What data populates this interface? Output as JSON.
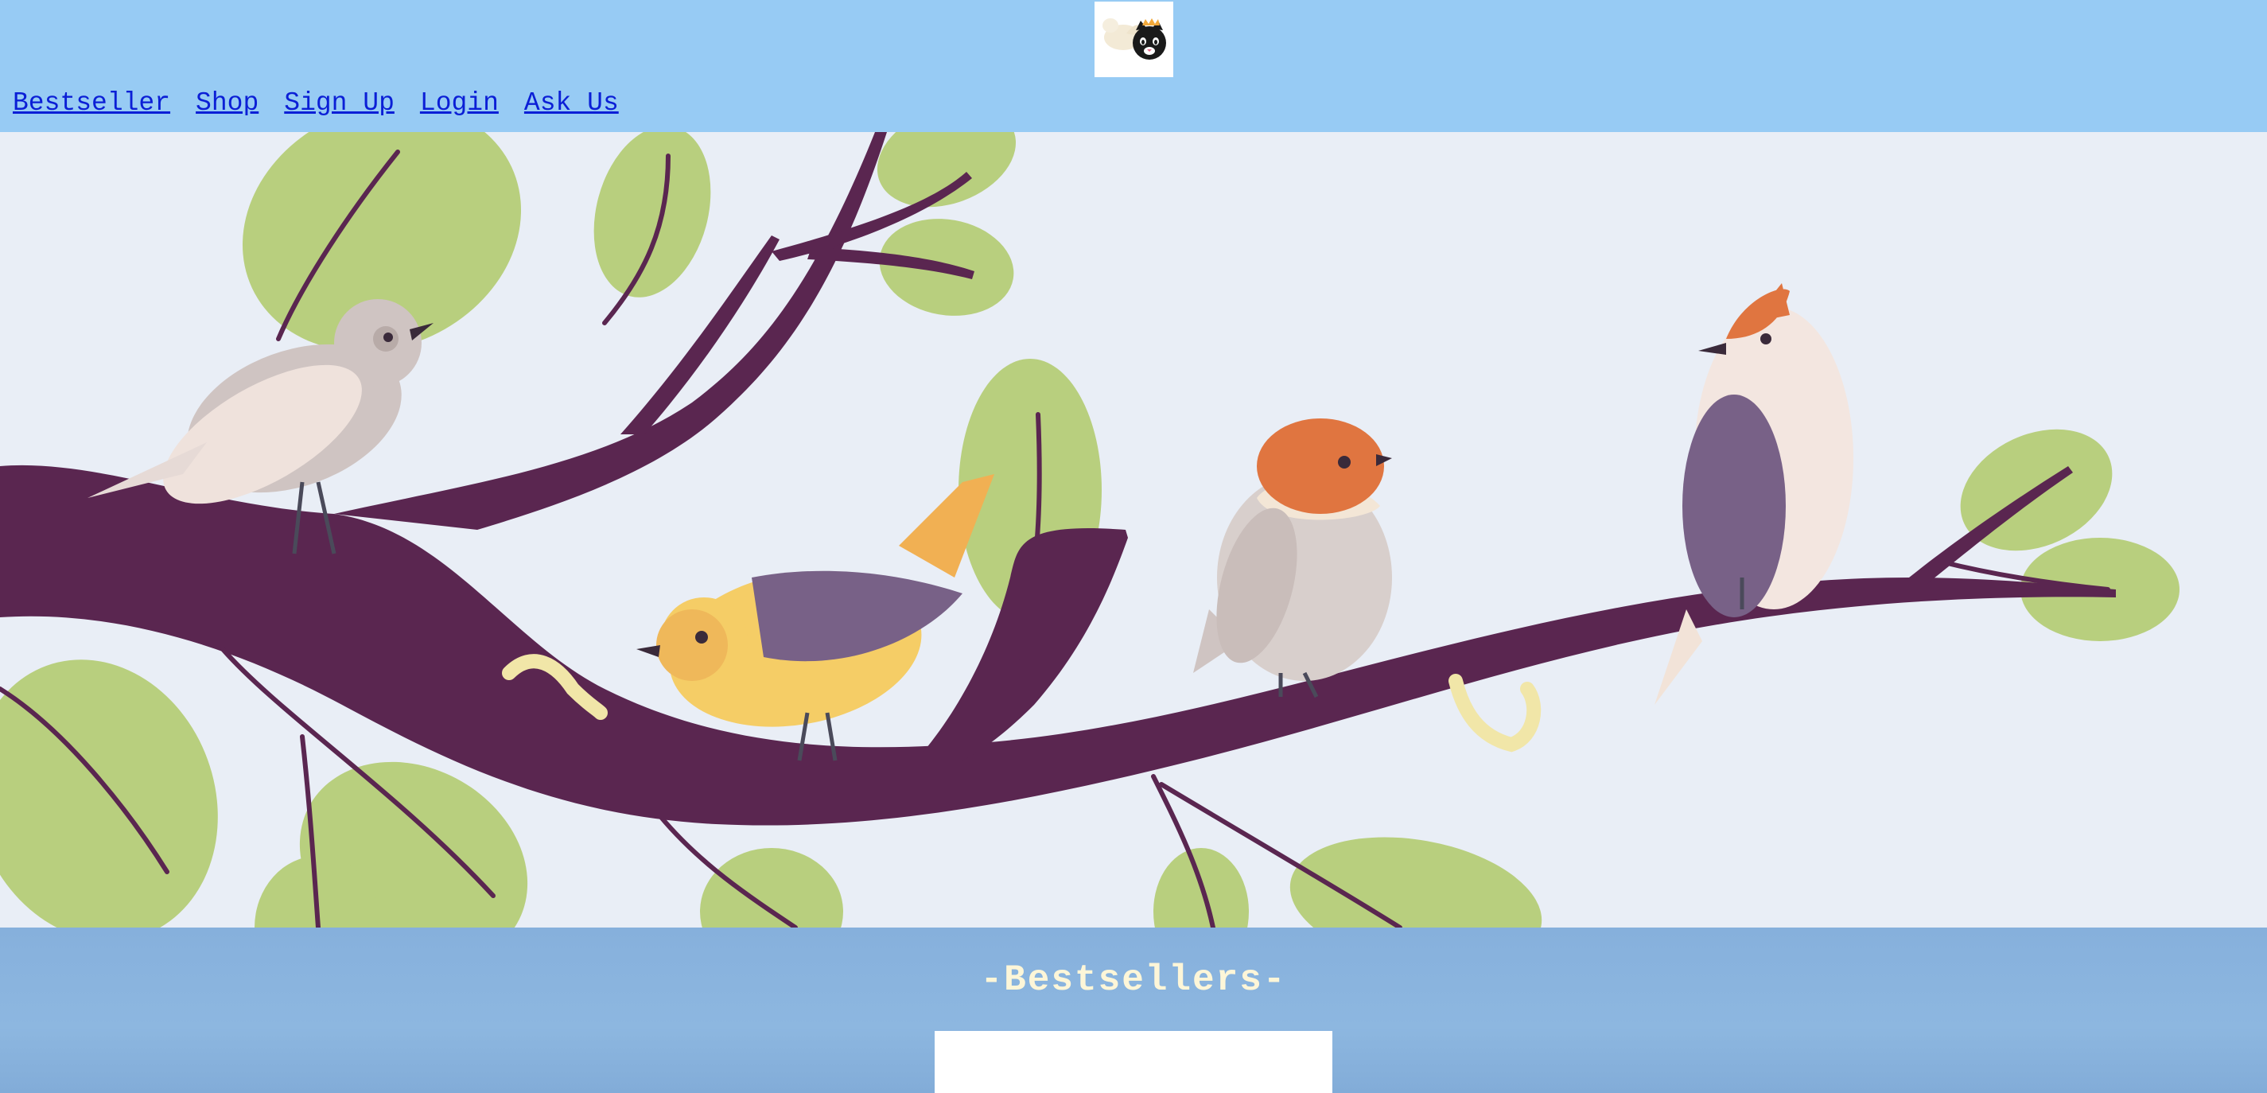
{
  "header": {
    "logo_icon": "cat-bird-logo-icon",
    "background_color": "#97cbf4"
  },
  "nav": {
    "items": [
      {
        "label": "Bestseller"
      },
      {
        "label": "Shop"
      },
      {
        "label": "Sign Up"
      },
      {
        "label": "Login"
      },
      {
        "label": "Ask Us"
      }
    ],
    "link_color": "#0b1fd6"
  },
  "hero": {
    "image": "birds-on-branch-illustration",
    "background_color": "#e9eef6"
  },
  "bestsellers": {
    "title": "-Bestsellers-",
    "title_color": "#fdf6d8",
    "background_color": "#86b0dc"
  }
}
